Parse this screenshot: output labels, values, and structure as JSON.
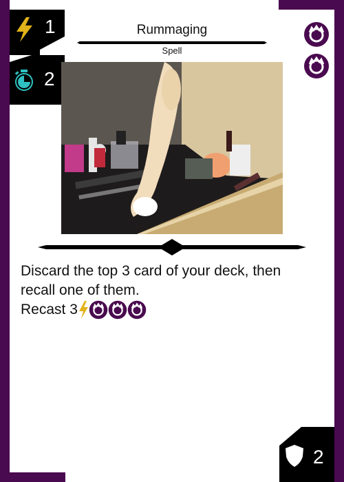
{
  "card": {
    "title": "Rummaging",
    "type_line": "Spell",
    "energy_cost": "1",
    "time_cost": "2",
    "defense": "2",
    "rules_text": {
      "line1": "Discard the top 3 card of your deck, then",
      "line2": "recall one of them.",
      "recast_label": "Recast 3"
    },
    "cost_pip_count": 2,
    "recast_pip_count": 3,
    "icons": {
      "energy": "lightning-bolt-icon",
      "time": "stopwatch-icon",
      "defense": "shield-icon",
      "pip": "flame-ring-icon"
    },
    "colors": {
      "frame": "#4a0a4f",
      "badge": "#000000",
      "energy": "#e2b31a",
      "time": "#2fc1c1",
      "pip": "#4a0a4f"
    }
  }
}
